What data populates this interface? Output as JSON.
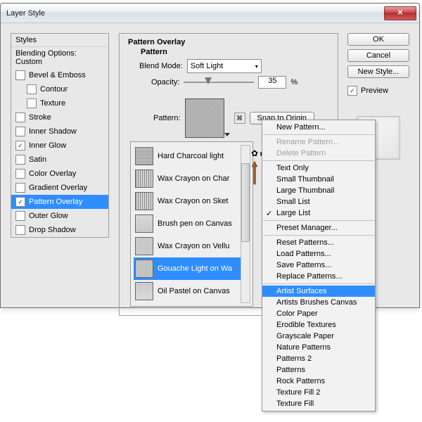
{
  "title": "Layer Style",
  "styles_header": "Styles",
  "blending": "Blending Options: Custom",
  "style_items": [
    {
      "label": "Bevel & Emboss",
      "checked": false
    },
    {
      "label": "Contour",
      "checked": false,
      "sub": true
    },
    {
      "label": "Texture",
      "checked": false,
      "sub": true
    },
    {
      "label": "Stroke",
      "checked": false
    },
    {
      "label": "Inner Shadow",
      "checked": false
    },
    {
      "label": "Inner Glow",
      "checked": true
    },
    {
      "label": "Satin",
      "checked": false
    },
    {
      "label": "Color Overlay",
      "checked": false
    },
    {
      "label": "Gradient Overlay",
      "checked": false
    },
    {
      "label": "Pattern Overlay",
      "checked": true,
      "selected": true
    },
    {
      "label": "Outer Glow",
      "checked": false
    },
    {
      "label": "Drop Shadow",
      "checked": false
    }
  ],
  "main": {
    "title": "Pattern Overlay",
    "sub": "Pattern",
    "blend_label": "Blend Mode:",
    "blend_value": "Soft Light",
    "opacity_label": "Opacity:",
    "opacity_value": "35",
    "percent": "%",
    "pattern_label": "Pattern:",
    "snap": "Snap to Origin"
  },
  "picker": [
    {
      "label": "Hard Charcoal light",
      "tex": "t-charcoal"
    },
    {
      "label": "Wax Crayon on Char",
      "tex": "t-crayon"
    },
    {
      "label": "Wax Crayon on Sket",
      "tex": "t-crayon"
    },
    {
      "label": "Brush pen on Canvas",
      "tex": "t-brush"
    },
    {
      "label": "Wax Crayon on Vellu",
      "tex": "t-vellum"
    },
    {
      "label": "Gouache Light on Wa",
      "tex": "t-gouache",
      "selected": true
    },
    {
      "label": "Oil Pastel on Canvas",
      "tex": "t-oil"
    }
  ],
  "buttons": {
    "ok": "OK",
    "cancel": "Cancel",
    "new_style": "New Style...",
    "preview": "Preview"
  },
  "menu": [
    {
      "label": "New Pattern..."
    },
    {
      "sep": true
    },
    {
      "label": "Rename Pattern...",
      "disabled": true
    },
    {
      "label": "Delete Pattern",
      "disabled": true
    },
    {
      "sep": true
    },
    {
      "label": "Text Only"
    },
    {
      "label": "Small Thumbnail"
    },
    {
      "label": "Large Thumbnail"
    },
    {
      "label": "Small List"
    },
    {
      "label": "Large List",
      "checked": true
    },
    {
      "sep": true
    },
    {
      "label": "Preset Manager..."
    },
    {
      "sep": true
    },
    {
      "label": "Reset Patterns..."
    },
    {
      "label": "Load Patterns..."
    },
    {
      "label": "Save Patterns..."
    },
    {
      "label": "Replace Patterns..."
    },
    {
      "sep": true
    },
    {
      "label": "Artist Surfaces",
      "selected": true
    },
    {
      "label": "Artists Brushes Canvas"
    },
    {
      "label": "Color Paper"
    },
    {
      "label": "Erodible Textures"
    },
    {
      "label": "Grayscale Paper"
    },
    {
      "label": "Nature Patterns"
    },
    {
      "label": "Patterns 2"
    },
    {
      "label": "Patterns"
    },
    {
      "label": "Rock Patterns"
    },
    {
      "label": "Texture Fill 2"
    },
    {
      "label": "Texture Fill"
    }
  ]
}
